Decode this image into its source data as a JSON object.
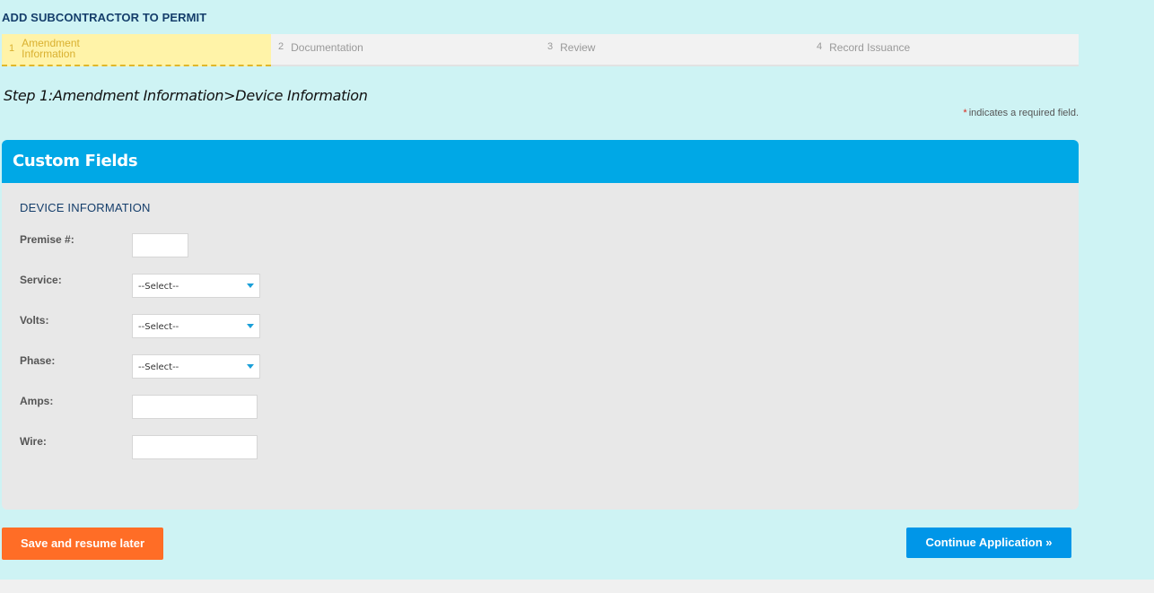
{
  "page": {
    "heading": "ADD SUBCONTRACTOR TO PERMIT"
  },
  "steps": [
    {
      "num": "1",
      "label": "Amendment Information",
      "active": true
    },
    {
      "num": "2",
      "label": "Documentation",
      "active": false
    },
    {
      "num": "3",
      "label": "Review",
      "active": false
    },
    {
      "num": "4",
      "label": "Record Issuance",
      "active": false
    }
  ],
  "step_title": "Step 1:Amendment Information>Device Information",
  "required_note": {
    "star": "*",
    "text": "indicates a required field."
  },
  "panel": {
    "title": "Custom Fields",
    "section_title": "DEVICE INFORMATION",
    "fields": {
      "premise": {
        "label": "Premise #:",
        "value": ""
      },
      "service": {
        "label": "Service:",
        "selected": "--Select--"
      },
      "volts": {
        "label": "Volts:",
        "selected": "--Select--"
      },
      "phase": {
        "label": "Phase:",
        "selected": "--Select--"
      },
      "amps": {
        "label": "Amps:",
        "value": ""
      },
      "wire": {
        "label": "Wire:",
        "value": ""
      }
    }
  },
  "buttons": {
    "save": "Save and resume later",
    "continue": "Continue Application »"
  },
  "colors": {
    "background": "#cef3f4",
    "panel_header": "#00a8e6",
    "save_button": "#ff6d26",
    "continue_button": "#0096e8",
    "active_step": "#fff3a8"
  }
}
